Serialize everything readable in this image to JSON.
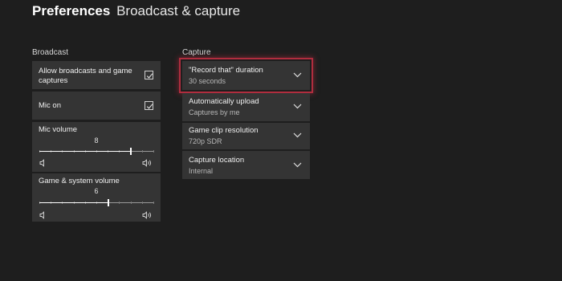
{
  "header": {
    "title_bold": "Preferences",
    "title_sub": "Broadcast & capture"
  },
  "broadcast": {
    "label": "Broadcast",
    "allow": {
      "label_line1": "Allow broadcasts and game",
      "label_line2": "captures",
      "checked": true
    },
    "mic_on": {
      "label": "Mic on",
      "checked": true
    },
    "mic_volume": {
      "label": "Mic volume",
      "value": "8",
      "level": 0.8
    },
    "game_volume": {
      "label": "Game & system volume",
      "value": "6",
      "level": 0.6
    }
  },
  "capture": {
    "label": "Capture",
    "items": [
      {
        "title": "\"Record that\" duration",
        "value": "30 seconds"
      },
      {
        "title": "Automatically upload",
        "value": "Captures by me"
      },
      {
        "title": "Game clip resolution",
        "value": "720p SDR"
      },
      {
        "title": "Capture location",
        "value": "Internal"
      }
    ]
  },
  "colors": {
    "background": "#1e1e1e",
    "tile": "#343434",
    "focus": "#b02d3e"
  }
}
